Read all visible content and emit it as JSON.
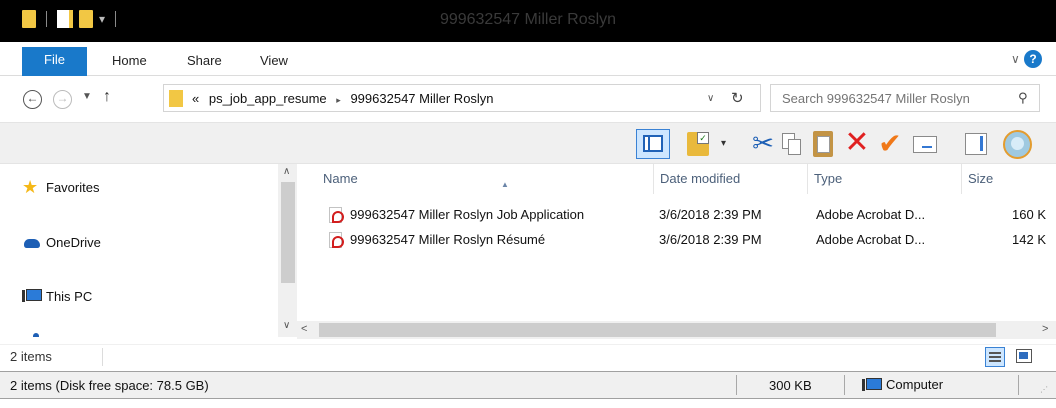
{
  "window": {
    "title": "999632547 Miller Roslyn"
  },
  "ribbon": {
    "tabs": [
      "File",
      "Home",
      "Share",
      "View"
    ]
  },
  "address": {
    "overflow": "«",
    "crumbs": [
      "ps_job_app_resume",
      "999632547 Miller Roslyn"
    ],
    "separator": "▸"
  },
  "search": {
    "placeholder": "Search 999632547 Miller Roslyn"
  },
  "toolbar": {
    "icons": [
      "preview-pane-icon",
      "properties-icon",
      "cut-icon",
      "copy-icon",
      "paste-icon",
      "delete-icon",
      "checkmark-icon",
      "rename-icon",
      "details-pane-icon",
      "globe-icon"
    ]
  },
  "nav": {
    "items": [
      "Favorites",
      "OneDrive",
      "This PC"
    ]
  },
  "columns": {
    "name": "Name",
    "date": "Date modified",
    "type": "Type",
    "size": "Size"
  },
  "files": [
    {
      "name": "999632547 Miller Roslyn Job Application",
      "date": "3/6/2018 2:39 PM",
      "type": "Adobe Acrobat D...",
      "size": "160 K"
    },
    {
      "name": "999632547 Miller Roslyn Résumé",
      "date": "3/6/2018 2:39 PM",
      "type": "Adobe Acrobat D...",
      "size": "142 K"
    }
  ],
  "status": {
    "item_count": "2 items",
    "detail": "2 items (Disk free space: 78.5 GB)",
    "total_size": "300 KB",
    "location": "Computer"
  },
  "colors": {
    "accent": "#1979ca",
    "titlebar": "#000000",
    "pdf_red": "#d21e1e",
    "folder_yellow": "#f2c744"
  }
}
